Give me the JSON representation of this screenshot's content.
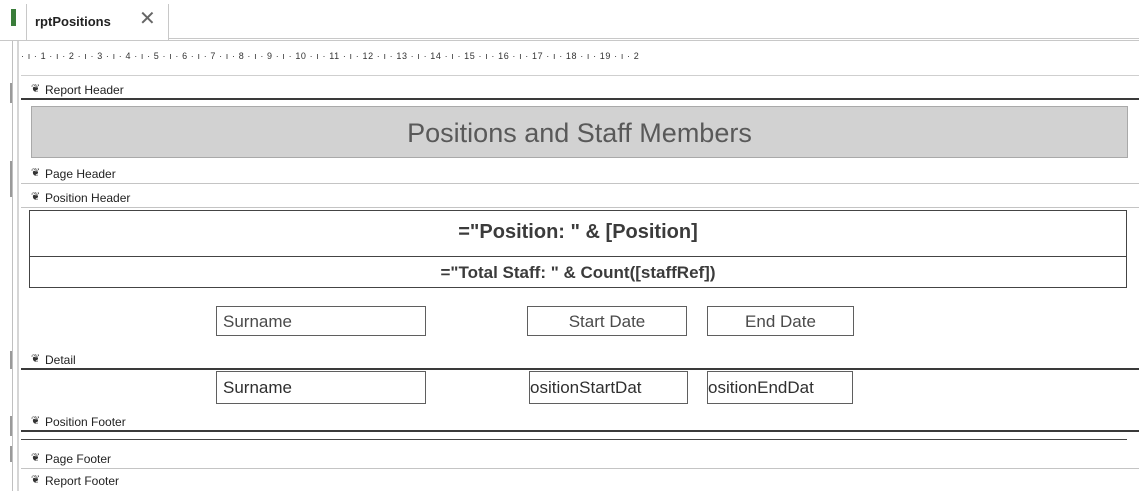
{
  "tab": {
    "title": "rptPositions",
    "close_symbol": "✕"
  },
  "ruler": {
    "numbers": "· ı · 1 · ı · 2 · ı · 3 · ı · 4 · ı · 5 · ı · 6 · ı · 7 · ı · 8 · ı · 9 · ı · 10 · ı · 11 · ı · 12 · ı · 13 · ı · 14 · ı · 15 · ı · 16 · ı · 17 · ı · 18 · ı · 19 · ı · 2"
  },
  "sections": {
    "report_header": "Report Header",
    "page_header": "Page Header",
    "position_header": "Position Header",
    "detail": "Detail",
    "position_footer": "Position Footer",
    "page_footer": "Page Footer",
    "report_footer": "Report Footer"
  },
  "section_arrow": "❦",
  "report_title": "Positions and Staff Members",
  "position_header": {
    "position_expr": "=\"Position: \" & [Position]",
    "total_expr": "=\"Total Staff: \" & Count([staffRef])",
    "label_surname": "Surname",
    "label_start_date": "Start Date",
    "label_end_date": "End Date"
  },
  "detail": {
    "field_surname": "Surname",
    "field_start": "ositionStartDat",
    "field_end": "ositionEndDat"
  }
}
